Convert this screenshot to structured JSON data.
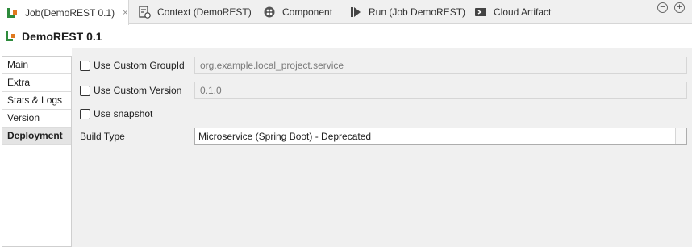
{
  "tabs": [
    {
      "label": "Job(DemoREST 0.1)",
      "icon": "job-icon",
      "active": true,
      "close": "×"
    },
    {
      "label": "Context (DemoREST)",
      "icon": "context-icon"
    },
    {
      "label": "Component",
      "icon": "component-icon"
    },
    {
      "label": "Run (Job DemoREST)",
      "icon": "run-icon"
    },
    {
      "label": "Cloud Artifact",
      "icon": "cloud-artifact-icon"
    }
  ],
  "window": {
    "minimize": "−",
    "maximize": "+"
  },
  "header": {
    "title": "DemoREST 0.1",
    "icon": "job-icon"
  },
  "sidebar": {
    "items": [
      {
        "label": "Main"
      },
      {
        "label": "Extra"
      },
      {
        "label": "Stats & Logs"
      },
      {
        "label": "Version"
      },
      {
        "label": "Deployment",
        "selected": true
      }
    ]
  },
  "deployment": {
    "custom_group_label": "Use Custom GroupId",
    "custom_group_value": "org.example.local_project.service",
    "custom_version_label": "Use Custom Version",
    "custom_version_value": "0.1.0",
    "snapshot_label": "Use snapshot",
    "build_type_label": "Build Type",
    "build_type_value": "Microservice (Spring Boot) - Deprecated"
  },
  "colors": {
    "tab_bg": "#f0f0f0",
    "panel_bg": "#f0f0f0",
    "selected_item": "#e4e4e4",
    "job_icon_green": "#2e8b3c",
    "job_icon_orange": "#e07a1f"
  }
}
